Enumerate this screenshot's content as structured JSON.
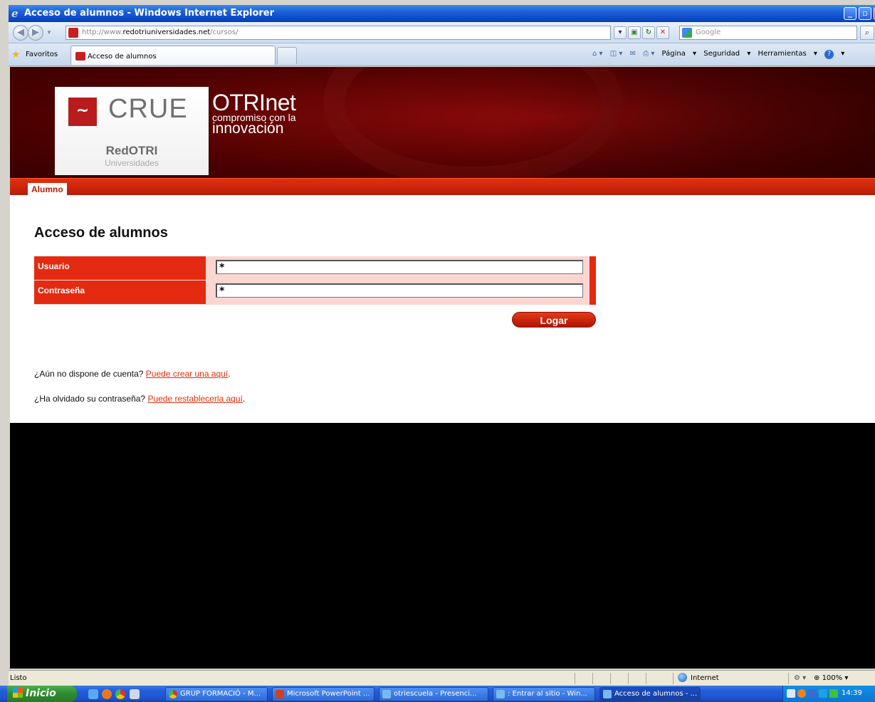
{
  "window": {
    "title": "Acceso de alumnos - Windows Internet Explorer"
  },
  "address": {
    "url_prefix": "http://www.",
    "url_domain": "redotriuniversidades.net",
    "url_path": "/cursos/",
    "search_placeholder": "Google"
  },
  "favorites": {
    "label": "Favoritos",
    "tab_title": "Acceso de alumnos"
  },
  "command_bar": {
    "page": "Página",
    "security": "Seguridad",
    "tools": "Herramientas"
  },
  "site": {
    "logo_crue": "CRUE",
    "logo_redotri": "RedOTRI",
    "logo_universidades": "Universidades",
    "otri": "OTRI",
    "net": "net",
    "tagline_1": "compromiso con la",
    "tagline_2": "innovación",
    "menu_alumno": "Alumno"
  },
  "login": {
    "heading": "Acceso de alumnos",
    "user_label": "Usuario",
    "user_value": "*",
    "password_label": "Contraseña",
    "password_value": "*",
    "submit": "Logar",
    "account_question": "¿Aún no dispone de cuenta? ",
    "account_link": "Puede crear una aquí",
    "password_question": "¿Ha olvidado su contraseña? ",
    "password_link": "Puede restablecerla aquí"
  },
  "status": {
    "text": "Listo",
    "zone": "Internet",
    "zoom": "100%"
  },
  "taskbar": {
    "start": "Inicio",
    "tasks": [
      "GRUP FORMACIÓ - M...",
      "Microsoft PowerPoint ...",
      "otriescuela - Presenci...",
      ": Entrar al sitio - Win...",
      "Acceso de alumnos - ..."
    ],
    "clock": "14:39"
  }
}
